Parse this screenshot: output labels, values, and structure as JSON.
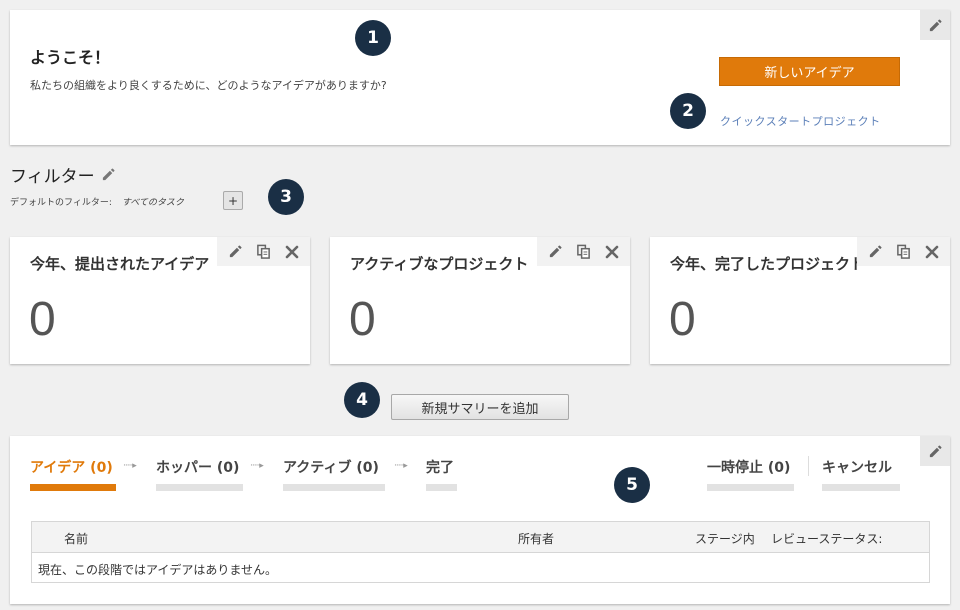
{
  "welcome": {
    "title": "ようこそ！",
    "subtitle": "私たちの組織をより良くするために、どのようなアイデアがありますか?",
    "new_idea_button": "新しいアイデア",
    "quickstart_link": "クイックスタートプロジェクト"
  },
  "badges": [
    "1",
    "2",
    "3",
    "4",
    "5"
  ],
  "filter": {
    "title": "フィルター",
    "default_label": "デフォルトのフィルター:",
    "default_value": "すべてのタスク",
    "add_label": "+"
  },
  "summaries": [
    {
      "title": "今年、提出されたアイデア",
      "value": "0"
    },
    {
      "title": "アクティブなプロジェクト",
      "value": "0"
    },
    {
      "title": "今年、完了したプロジェクト",
      "value": "0"
    }
  ],
  "add_summary_button": "新規サマリーを追加",
  "stages": [
    {
      "label": "アイデア (0)"
    },
    {
      "label": "ホッパー (0)"
    },
    {
      "label": "アクティブ (0)"
    },
    {
      "label": "完了"
    },
    {
      "label": "一時停止 (0)"
    },
    {
      "label": "キャンセル"
    }
  ],
  "stage_arrow": "·····▸",
  "table": {
    "columns": [
      "名前",
      "所有者",
      "ステージ内",
      "レビューステータス:"
    ],
    "empty_message": "現在、この段階ではアイデアはありません。"
  },
  "icons": {
    "edit": "pencil-icon",
    "copy": "copy-icon",
    "close": "close-icon"
  },
  "colors": {
    "accent": "#e07a0b",
    "badge": "#1a2f45",
    "link": "#5b7fb8"
  }
}
